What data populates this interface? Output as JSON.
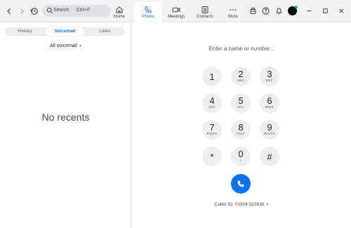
{
  "titlebar": {
    "search_label": "Search",
    "search_shortcut": "Ctrl+F",
    "tabs": [
      {
        "label": "Home",
        "icon": "home-icon"
      },
      {
        "label": "Phone",
        "icon": "phone-icon",
        "active": true
      },
      {
        "label": "Meetings",
        "icon": "video-camera-icon"
      },
      {
        "label": "Contacts",
        "icon": "contacts-icon"
      },
      {
        "label": "More",
        "icon": "more-dots-icon"
      }
    ]
  },
  "left_panel": {
    "segments": [
      "History",
      "Voicemail",
      "Lines"
    ],
    "selected_segment": "Voicemail",
    "filter": "All voicemail",
    "empty_text": "No recents"
  },
  "dialer": {
    "placeholder": "Enter a name or number...",
    "keys": [
      {
        "digit": "1",
        "letters": ""
      },
      {
        "digit": "2",
        "letters": "ABC"
      },
      {
        "digit": "3",
        "letters": "DEF"
      },
      {
        "digit": "4",
        "letters": "GHI"
      },
      {
        "digit": "5",
        "letters": "JKL"
      },
      {
        "digit": "6",
        "letters": "MNO"
      },
      {
        "digit": "7",
        "letters": "PQRS"
      },
      {
        "digit": "8",
        "letters": "TUV"
      },
      {
        "digit": "9",
        "letters": "WXYZ"
      },
      {
        "digit": "*",
        "letters": ""
      },
      {
        "digit": "0",
        "letters": "+"
      },
      {
        "digit": "#",
        "letters": ""
      }
    ],
    "caller_id": "Caller ID: 01904 323838"
  },
  "colors": {
    "accent": "#0e72ed",
    "key_bg": "#eeeef1",
    "status_online": "#1fb950"
  }
}
